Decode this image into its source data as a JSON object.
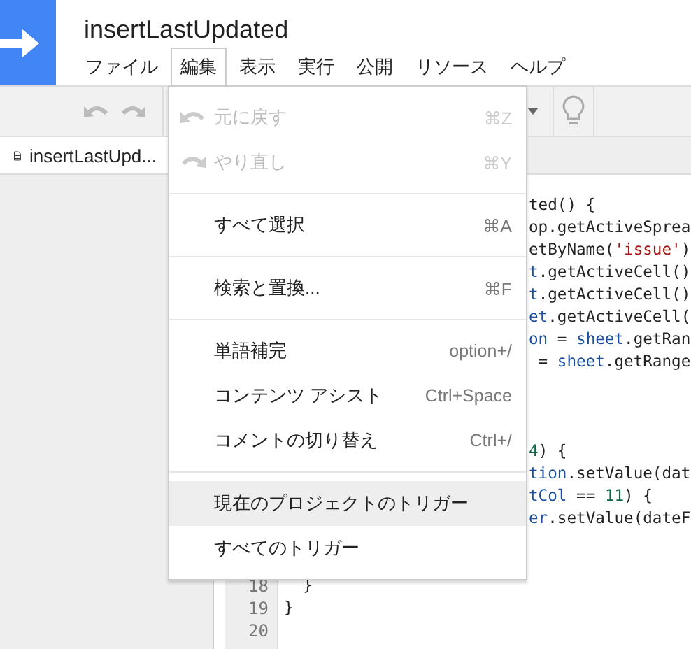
{
  "project_title": "insertLastUpdated",
  "menubar": [
    {
      "label": "ファイル",
      "selected": false
    },
    {
      "label": "編集",
      "selected": true
    },
    {
      "label": "表示",
      "selected": false
    },
    {
      "label": "実行",
      "selected": false
    },
    {
      "label": "公開",
      "selected": false
    },
    {
      "label": "リソース",
      "selected": false
    },
    {
      "label": "ヘルプ",
      "selected": false
    }
  ],
  "file_tab": {
    "label": "insertLastUpd..."
  },
  "edit_menu": [
    {
      "kind": "item",
      "label": "元に戻す",
      "shortcut": "⌘Z",
      "disabled": true,
      "selected": false
    },
    {
      "kind": "item",
      "label": "やり直し",
      "shortcut": "⌘Y",
      "disabled": true,
      "selected": false
    },
    {
      "kind": "separator"
    },
    {
      "kind": "item",
      "label": "すべて選択",
      "shortcut": "⌘A",
      "disabled": false,
      "selected": false
    },
    {
      "kind": "separator"
    },
    {
      "kind": "item",
      "label": "検索と置換...",
      "shortcut": "⌘F",
      "disabled": false,
      "selected": false
    },
    {
      "kind": "separator"
    },
    {
      "kind": "item",
      "label": "単語補完",
      "shortcut": "option+/",
      "disabled": false,
      "selected": false
    },
    {
      "kind": "item",
      "label": "コンテンツ アシスト",
      "shortcut": "Ctrl+Space",
      "disabled": false,
      "selected": false
    },
    {
      "kind": "item",
      "label": "コメントの切り替え",
      "shortcut": "Ctrl+/",
      "disabled": false,
      "selected": false
    },
    {
      "kind": "separator"
    },
    {
      "kind": "item",
      "label": "現在のプロジェクトのトリガー",
      "disabled": false,
      "selected": true
    },
    {
      "kind": "item",
      "label": "すべてのトリガー",
      "disabled": false,
      "selected": false
    }
  ],
  "code_lines": [
    {
      "kind": "partial",
      "segments": [
        {
          "kind": "plain",
          "text": "ted() {"
        }
      ]
    },
    {
      "kind": "partial",
      "segments": [
        {
          "kind": "plain",
          "text": "op.getActiveSprea"
        }
      ]
    },
    {
      "kind": "partial",
      "segments": [
        {
          "kind": "plain",
          "text": "etByName("
        },
        {
          "kind": "string",
          "text": "'issue'"
        },
        {
          "kind": "plain",
          "text": ")"
        }
      ]
    },
    {
      "kind": "partial",
      "segments": [
        {
          "kind": "variable",
          "text": "t"
        },
        {
          "kind": "plain",
          "text": ".getActiveCell()"
        }
      ]
    },
    {
      "kind": "partial",
      "segments": [
        {
          "kind": "variable",
          "text": "t"
        },
        {
          "kind": "plain",
          "text": ".getActiveCell()"
        }
      ]
    },
    {
      "kind": "partial",
      "segments": [
        {
          "kind": "variable",
          "text": "et"
        },
        {
          "kind": "plain",
          "text": ".getActiveCell("
        }
      ]
    },
    {
      "kind": "partial",
      "segments": [
        {
          "kind": "variable",
          "text": "on"
        },
        {
          "kind": "plain",
          "text": " = "
        },
        {
          "kind": "variable",
          "text": "sheet"
        },
        {
          "kind": "plain",
          "text": ".getRan"
        }
      ]
    },
    {
      "kind": "partial",
      "segments": [
        {
          "kind": "plain",
          "text": " = "
        },
        {
          "kind": "variable",
          "text": "sheet"
        },
        {
          "kind": "plain",
          "text": ".getRange"
        }
      ]
    },
    {
      "kind": "partial"
    },
    {
      "kind": "partial"
    },
    {
      "kind": "partial"
    },
    {
      "kind": "partial",
      "segments": [
        {
          "kind": "number",
          "text": "4"
        },
        {
          "kind": "plain",
          "text": ") {"
        }
      ]
    },
    {
      "kind": "partial",
      "segments": [
        {
          "kind": "variable",
          "text": "tion"
        },
        {
          "kind": "plain",
          "text": ".setValue(dat"
        }
      ]
    },
    {
      "kind": "partial",
      "segments": [
        {
          "kind": "variable",
          "text": "tCol"
        },
        {
          "kind": "plain",
          "text": " == "
        },
        {
          "kind": "number",
          "text": "11"
        },
        {
          "kind": "plain",
          "text": ") {"
        }
      ]
    },
    {
      "kind": "partial",
      "segments": [
        {
          "kind": "variable",
          "text": "er"
        },
        {
          "kind": "plain",
          "text": ".setValue(dateF"
        }
      ]
    },
    {
      "kind": "partial"
    },
    {
      "kind": "partial"
    },
    {
      "kind": "full",
      "number": "18",
      "segments": [
        {
          "kind": "plain",
          "text": "  }"
        }
      ]
    },
    {
      "kind": "full",
      "number": "19",
      "segments": [
        {
          "kind": "plain",
          "text": "}"
        }
      ]
    },
    {
      "kind": "full",
      "number": "20"
    }
  ]
}
